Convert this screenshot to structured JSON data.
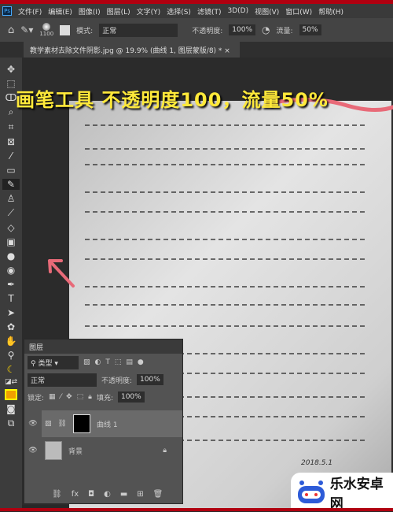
{
  "menu": {
    "logo": "Ps",
    "items": [
      "文件(F)",
      "编辑(E)",
      "图像(I)",
      "图层(L)",
      "文字(Y)",
      "选择(S)",
      "滤镜(T)",
      "3D(D)",
      "视图(V)",
      "窗口(W)",
      "帮助(H)"
    ]
  },
  "options": {
    "brush_size": "1100",
    "mode_label": "模式:",
    "mode_value": "正常",
    "opacity_label": "不透明度:",
    "opacity_value": "100%",
    "flow_label": "流量:",
    "flow_value": "50%"
  },
  "tab": {
    "title": "教学素材去除文件阴影.jpg @ 19.9% (曲线 1, 图层蒙版/8) *",
    "close": "×"
  },
  "caption": "画笔工具 不透明度100，流量50%",
  "layers_panel": {
    "title": "图层",
    "filter": "类型",
    "blend": "正常",
    "opacity_label": "不透明度:",
    "opacity": "100%",
    "lock_label": "锁定:",
    "fill_label": "填充:",
    "fill": "100%",
    "layers": [
      {
        "name": "曲线 1",
        "visible": true,
        "active": true
      },
      {
        "name": "背景",
        "visible": true,
        "locked": true
      }
    ]
  },
  "doc_signature": "2018.5.1",
  "watermark": "乐水安卓网",
  "colors": {
    "accent_red": "#b00010",
    "caption_yellow": "#ffe93a",
    "annotation_pink": "#e86a78"
  }
}
